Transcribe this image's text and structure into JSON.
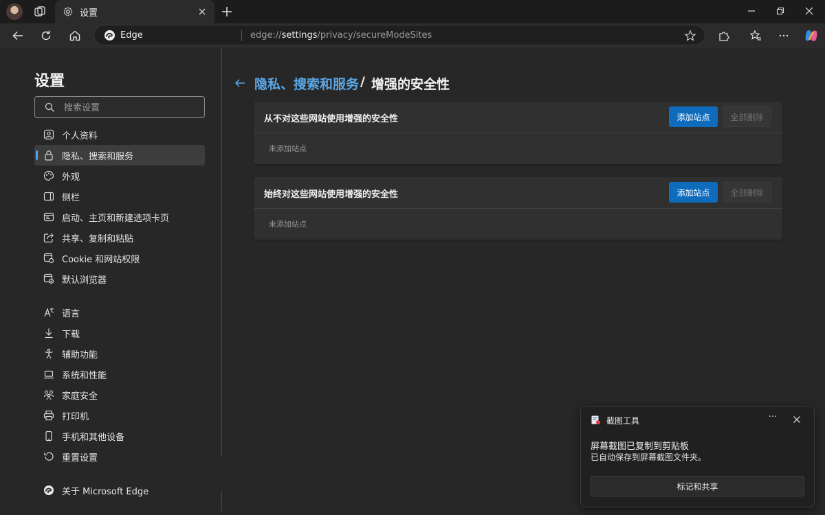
{
  "browser": {
    "tab_title": "设置",
    "edge_label": "Edge",
    "url_prefix": "edge://",
    "url_host": "settings",
    "url_path": "/privacy/secureModeSites"
  },
  "sidebar": {
    "title": "设置",
    "search_placeholder": "搜索设置",
    "items": [
      {
        "label": "个人资料",
        "icon": "profile-icon"
      },
      {
        "label": "隐私、搜索和服务",
        "icon": "lock-icon"
      },
      {
        "label": "外观",
        "icon": "palette-icon"
      },
      {
        "label": "侧栏",
        "icon": "sidebar-icon"
      },
      {
        "label": "启动、主页和新建选项卡页",
        "icon": "startup-icon"
      },
      {
        "label": "共享、复制和粘贴",
        "icon": "share-icon"
      },
      {
        "label": "Cookie 和网站权限",
        "icon": "cookie-icon"
      },
      {
        "label": "默认浏览器",
        "icon": "default-browser-icon"
      },
      {
        "label": "语言",
        "icon": "language-icon"
      },
      {
        "label": "下载",
        "icon": "download-icon"
      },
      {
        "label": "辅助功能",
        "icon": "accessibility-icon"
      },
      {
        "label": "系统和性能",
        "icon": "laptop-icon"
      },
      {
        "label": "家庭安全",
        "icon": "family-icon"
      },
      {
        "label": "打印机",
        "icon": "printer-icon"
      },
      {
        "label": "手机和其他设备",
        "icon": "phone-icon"
      },
      {
        "label": "重置设置",
        "icon": "reset-icon"
      },
      {
        "label": "关于 Microsoft Edge",
        "icon": "edge-logo-icon"
      }
    ]
  },
  "main": {
    "breadcrumb_link": "隐私、搜索和服务",
    "breadcrumb_sep": "/",
    "breadcrumb_current": "增强的安全性",
    "cards": [
      {
        "title": "从不对这些网站使用增强的安全性",
        "add_label": "添加站点",
        "delete_label": "全部删除",
        "empty_text": "未添加站点"
      },
      {
        "title": "始终对这些网站使用增强的安全性",
        "add_label": "添加站点",
        "delete_label": "全部删除",
        "empty_text": "未添加站点"
      }
    ]
  },
  "toast": {
    "app_name": "截图工具",
    "more_label": "···",
    "title": "屏幕截图已复制到剪贴板",
    "body": "已自动保存到屏幕截图文件夹。",
    "action_label": "标记和共享"
  },
  "colors": {
    "accent": "#0f6cbd",
    "link": "#5aa7e6",
    "background": "#272727"
  }
}
